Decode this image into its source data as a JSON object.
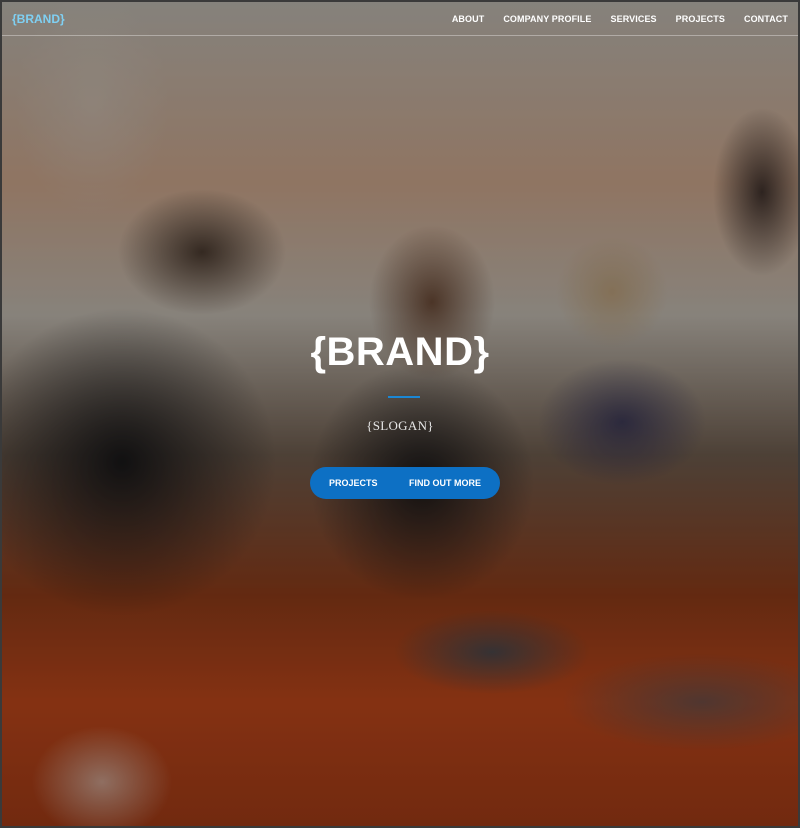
{
  "navbar": {
    "brand": "{BRAND}",
    "links": [
      "ABOUT",
      "COMPANY PROFILE",
      "SERVICES",
      "PROJECTS",
      "CONTACT"
    ]
  },
  "hero": {
    "title": "{BRAND}",
    "slogan": "{SLOGAN}",
    "buttons": {
      "projects": "PROJECTS",
      "find_out_more": "FIND OUT MORE"
    }
  },
  "colors": {
    "brand_accent": "#7fd0f3",
    "button_blue": "#0d70c4",
    "divider_blue": "#1b87d4"
  }
}
